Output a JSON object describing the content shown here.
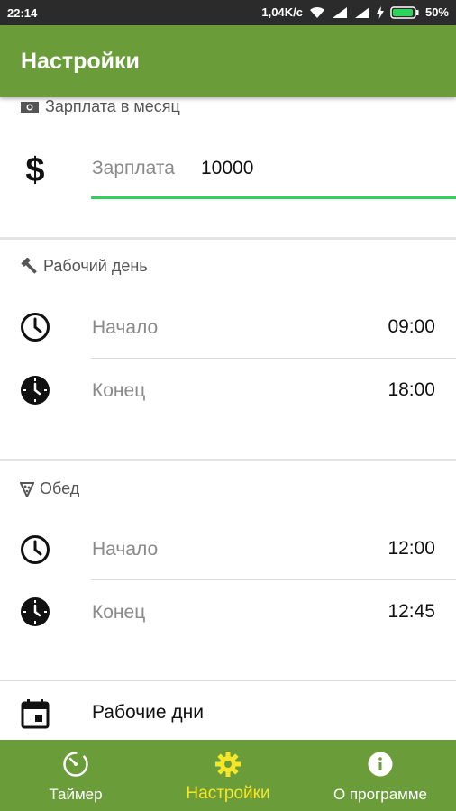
{
  "status_bar": {
    "time": "22:14",
    "speed": "1,04K/c",
    "battery": "50%"
  },
  "app_bar": {
    "title": "Настройки"
  },
  "salary_section": {
    "header": "Зарплата в месяц",
    "icon": "dollar-icon",
    "field_label": "Зарплата",
    "field_value": "10000"
  },
  "workday_section": {
    "header": "Рабочий день",
    "start_label": "Начало",
    "start_value": "09:00",
    "end_label": "Конец",
    "end_value": "18:00"
  },
  "lunch_section": {
    "header": "Обед",
    "start_label": "Начало",
    "start_value": "12:00",
    "end_label": "Конец",
    "end_value": "12:45"
  },
  "workdays_row": {
    "label": "Рабочие дни",
    "icon": "calendar-icon"
  },
  "bottom_nav": {
    "items": [
      {
        "label": "Таймер",
        "icon": "timer-icon"
      },
      {
        "label": "Настройки",
        "icon": "settings-icon",
        "active": true
      },
      {
        "label": "О программе",
        "icon": "info-icon"
      }
    ]
  },
  "colors": {
    "primary": "#6a9d3a",
    "accent_active": "#f5e62a",
    "input_underline": "#2fd35c",
    "status_bar": "#2b2b2b"
  }
}
